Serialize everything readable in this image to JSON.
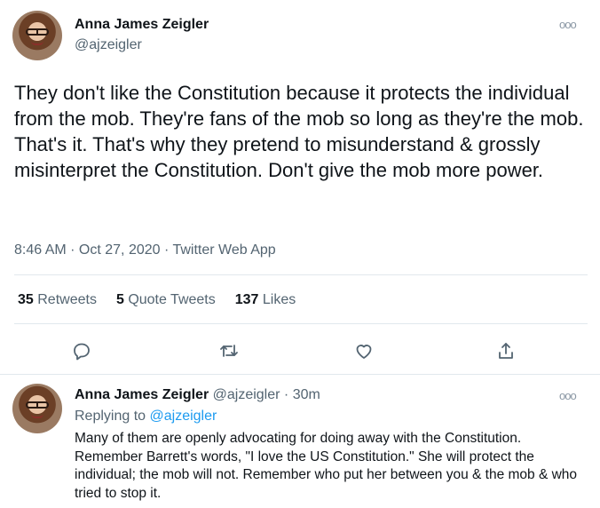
{
  "tweet": {
    "author_name": "Anna James Zeigler",
    "author_handle": "@ajzeigler",
    "more_icon": "ooo",
    "text": "They don't like the Constitution because it protects the individual from the mob. They're fans of the mob so long as they're the mob. That's it. That's why they pretend to misunderstand & grossly misinterpret the Constitution. Don't give the mob more power.",
    "timestamp": "8:46 AM · Oct 27, 2020 · Twitter Web App",
    "stats": {
      "retweets_count": "35",
      "retweets_label": "Retweets",
      "quote_count": "5",
      "quote_label": "Quote Tweets",
      "likes_count": "137",
      "likes_label": "Likes"
    },
    "actions": [
      "reply-icon",
      "retweet-icon",
      "like-icon",
      "share-icon"
    ]
  },
  "reply": {
    "author_name": "Anna James Zeigler",
    "author_handle": "@ajzeigler",
    "separator": "·",
    "time": "30m",
    "more_icon": "ooo",
    "replying_prefix": "Replying to",
    "replying_handle": "@ajzeigler",
    "text": "Many of them are openly advocating for doing away with the Constitution. Remember Barrett's words, \"I love the US Constitution.\" She will protect the individual; the mob will not. Remember who put her between you & the mob & who tried to stop it."
  },
  "colors": {
    "text": "#0f1419",
    "secondary": "#536471",
    "link": "#1d9bf0",
    "divider": "#e1e8ed"
  }
}
